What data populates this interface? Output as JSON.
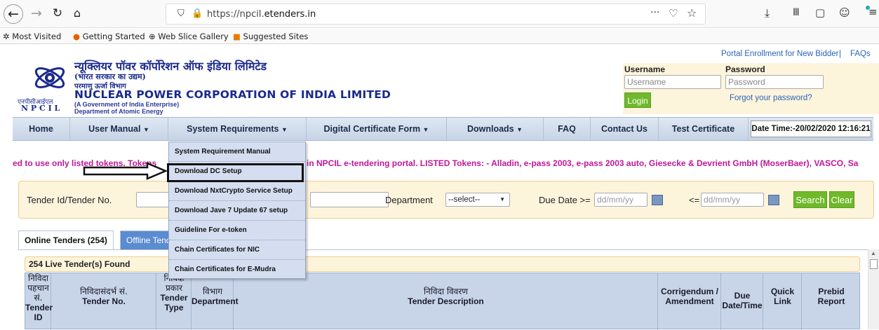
{
  "browser": {
    "url_prefix": "https://npcil.",
    "url_domain": "etenders.in",
    "url_suffix": "",
    "overflow": "···"
  },
  "bookmarks": [
    "Most Visited",
    "Getting Started",
    "Web Slice Gallery",
    "Suggested Sites"
  ],
  "header": {
    "hindi_title": "न्यूक्लियर पॉवर कॉर्पोरेशन ऑफ इंडिया लिमिटेड",
    "hindi_sub1": "(भारत सरकार का उद्यम)",
    "hindi_sub2": "परमाणु ऊर्जा विभाग",
    "title": "NUCLEAR POWER CORPORATION OF INDIA LIMITED",
    "sub1": "(A Government of India Enterprise)",
    "sub2": "Department of Atomic Energy",
    "logo_hindi": "एनपीसीआईएल",
    "logo_text": "N P C I L",
    "portal_enroll": "Portal Enrollment for New Bidder",
    "sep": "|",
    "faqs": "FAQs",
    "username_label": "Username",
    "username_placeholder": "Username",
    "password_label": "Password",
    "password_placeholder": "Password",
    "login": "Login",
    "forgot": "Forgot your password?"
  },
  "nav": {
    "home": "Home",
    "user_manual": "User Manual",
    "system_requirements": "System Requirements",
    "digital_cert": "Digital Certificate Form",
    "downloads": "Downloads",
    "faq": "FAQ",
    "contact": "Contact Us",
    "test_cert": "Test Certificate",
    "datetime": "Date Time:-20/02/2020 12:16:21"
  },
  "dropdown": [
    "System Requirement Manual",
    "Download DC Setup",
    "Download NxtCrypto Service Setup",
    "Download Jave 7 Update 67 setup",
    "Guideline For e-token",
    "Chain Certificates for NIC",
    "Chain Certificates for E-Mudra"
  ],
  "marquee_left": "ed to use only listed tokens. Tokens",
  "marquee_right": "in NPCIL e-tendering portal. LISTED Tokens: - Alladin, e-pass 2003, e-pass 2003 auto, Giesecke & Devrient GmbH (MoserBaer), VASCO, Sa",
  "search": {
    "tender_label": "Tender Id/Tender No.",
    "department_label": "Department",
    "department_value": "--select--",
    "due_label": "Due Date >=",
    "due_placeholder": "dd/mm/yy",
    "le_label": "<=",
    "le_placeholder": "dd/mm/yy",
    "search": "Search",
    "clear": "Clear"
  },
  "tabs": {
    "online": "Online Tenders (254)",
    "offline": "Offline Tend"
  },
  "live_found": "254 Live Tender(s) Found",
  "table_headers": {
    "c1_hi1": "निविदा",
    "c1_hi2": "पहचान",
    "c1_hi3": "सं.",
    "c1_en1": "Tender",
    "c1_en2": "ID",
    "c2_hi": "निविदासंदर्भ सं.",
    "c2_en": "Tender No.",
    "c3_hi1": "निविदा",
    "c3_hi2": "प्रकार",
    "c3_en1": "Tender",
    "c3_en2": "Type",
    "c4_hi": "विभाग",
    "c4_en": "Department",
    "c5_hi": "निविदा विवरण",
    "c5_en": "Tender Description",
    "c6_en1": "Corrigendum /",
    "c6_en2": "Amendment",
    "c7_en1": "Due",
    "c7_en2": "Date/Time",
    "c8_en1": "Quick",
    "c8_en2": "Link",
    "c9_en1": "Prebid",
    "c9_en2": "Report"
  },
  "colors": {
    "nav_bg": "#c6d4e6",
    "marquee": "#c0189a",
    "button_green": "#6fb92b",
    "search_bg": "#fdf4dc"
  }
}
